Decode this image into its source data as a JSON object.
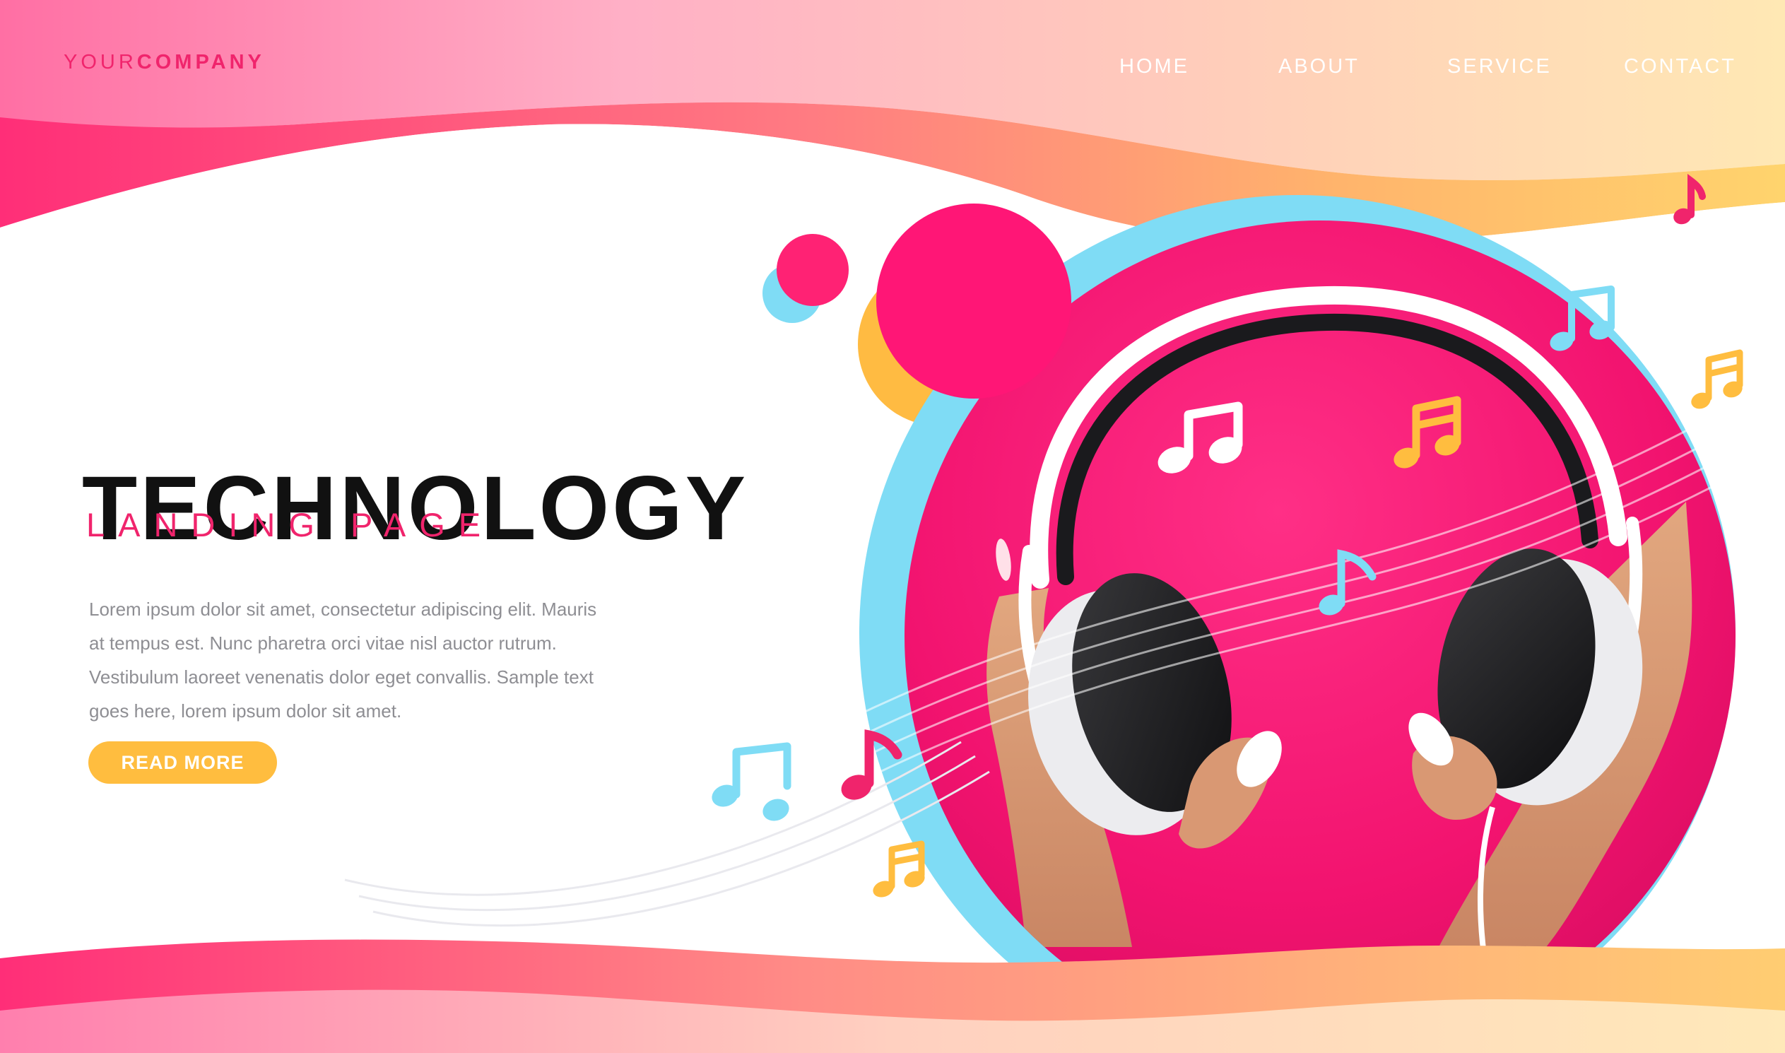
{
  "header": {
    "brand_light": "YOUR",
    "brand_bold": "COMPANY",
    "nav": [
      "HOME",
      "ABOUT",
      "SERVICE",
      "CONTACT"
    ]
  },
  "hero": {
    "title": "TECHNOLOGY",
    "subtitle": "LANDING PAGE",
    "body": "Lorem ipsum dolor sit amet, consectetur adipiscing elit. Mauris at tempus est. Nunc pharetra orci vitae nisl auctor rutrum. Vestibulum laoreet venenatis dolor eget convallis. Sample text goes here, lorem ipsum dolor sit amet.",
    "cta": "READ MORE"
  },
  "image": {
    "subject": "hands-holding-headphones"
  },
  "colors": {
    "pink": "#f0246c",
    "orange": "#ffb45c",
    "yellow": "#ffbd3f",
    "cyan": "#7fdcf5",
    "peach": "#ffe6b7",
    "text_dark": "#111111",
    "text_gray": "#8e8e93"
  },
  "icons": [
    "music-note-white",
    "music-note-yellow",
    "music-note-cyan",
    "music-note-pink",
    "headphones"
  ]
}
